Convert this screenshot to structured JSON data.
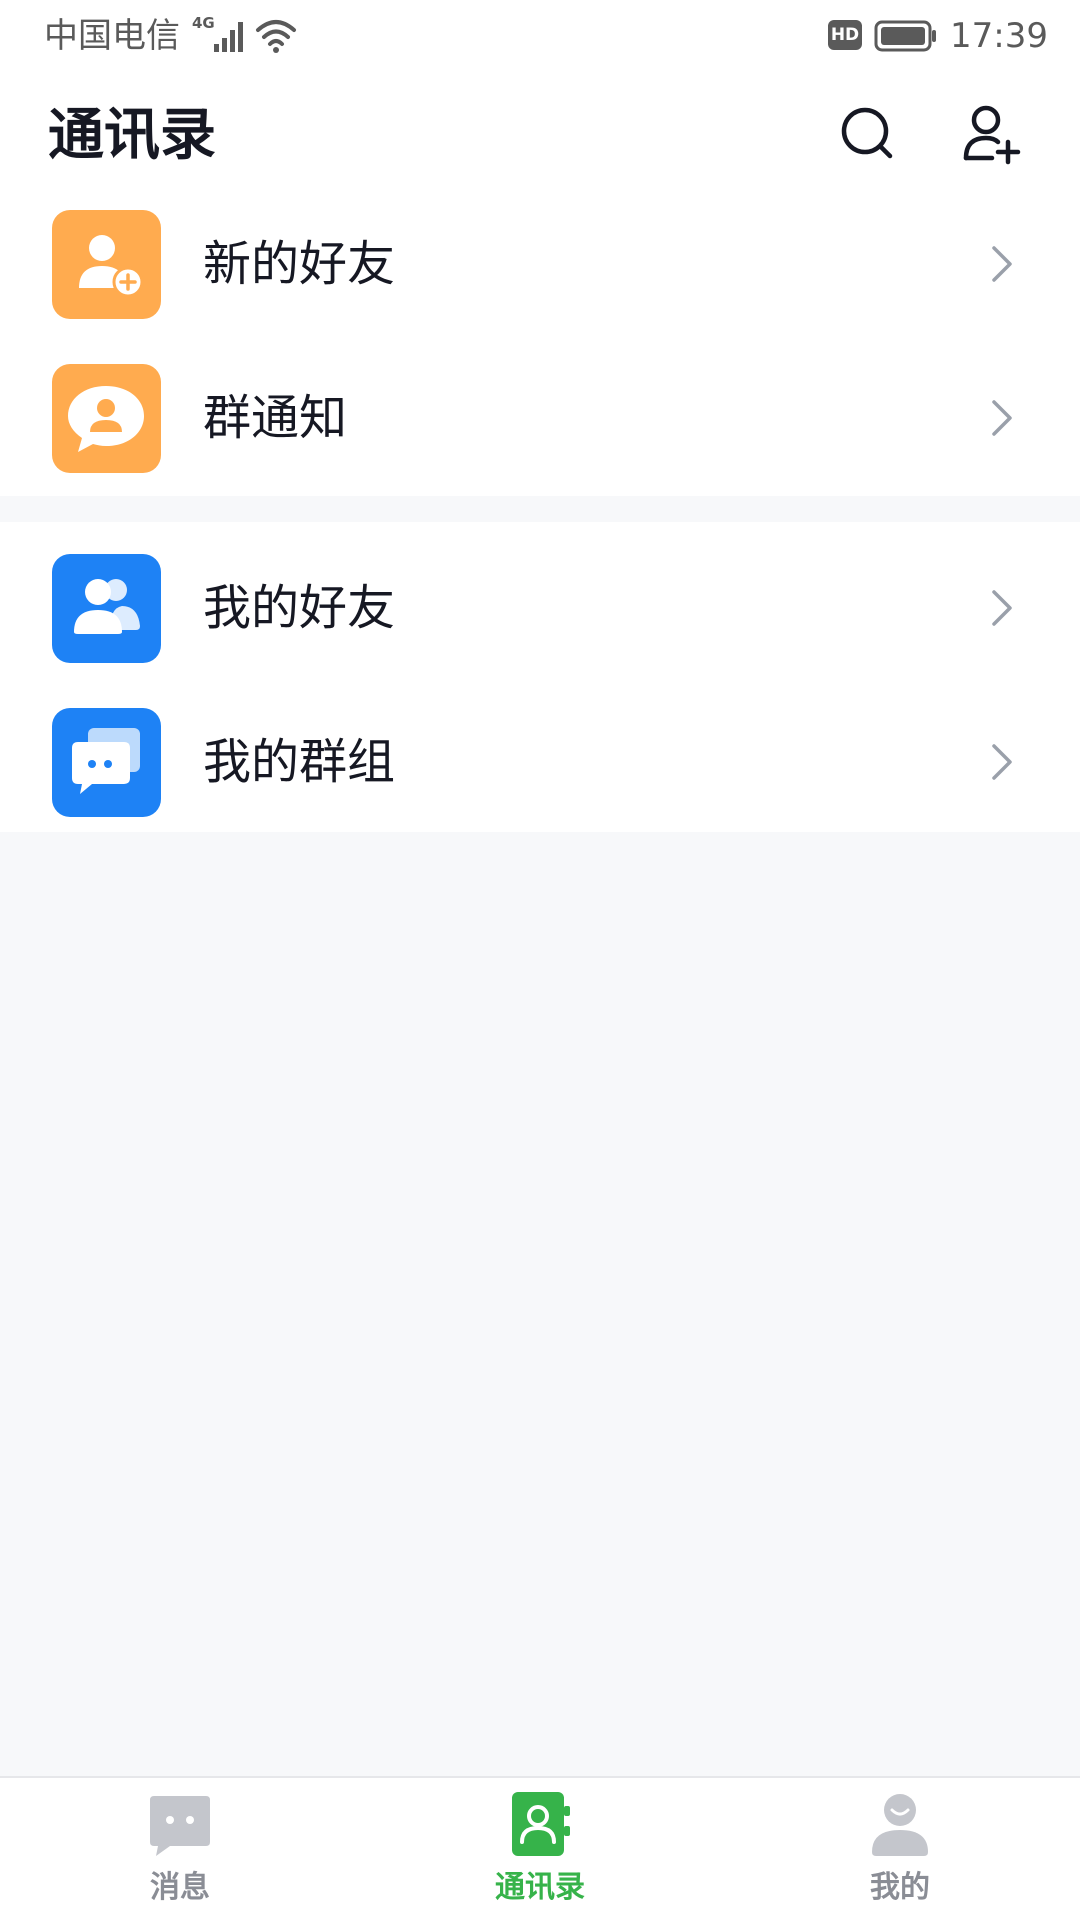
{
  "status_bar": {
    "carrier": "中国电信",
    "network": "4G",
    "hd": "HD",
    "time": "17:39"
  },
  "header": {
    "title": "通讯录",
    "search_icon": "search-icon",
    "add_icon": "add-user-icon"
  },
  "list": {
    "items": [
      {
        "label": "新的好友",
        "icon": "add-friend-icon",
        "color": "#FFAB4F"
      },
      {
        "label": "群通知",
        "icon": "group-notice-icon",
        "color": "#FFAB4F"
      },
      {
        "label": "我的好友",
        "icon": "friends-icon",
        "color": "#1E82F5"
      },
      {
        "label": "我的群组",
        "icon": "groups-icon",
        "color": "#1E82F5"
      }
    ]
  },
  "tabbar": {
    "tabs": [
      {
        "label": "消息",
        "icon": "message-icon",
        "active": false
      },
      {
        "label": "通讯录",
        "icon": "contacts-icon",
        "active": true
      },
      {
        "label": "我的",
        "icon": "profile-icon",
        "active": false
      }
    ],
    "active_color": "#36B34A",
    "inactive_color": "#8A8D95"
  }
}
